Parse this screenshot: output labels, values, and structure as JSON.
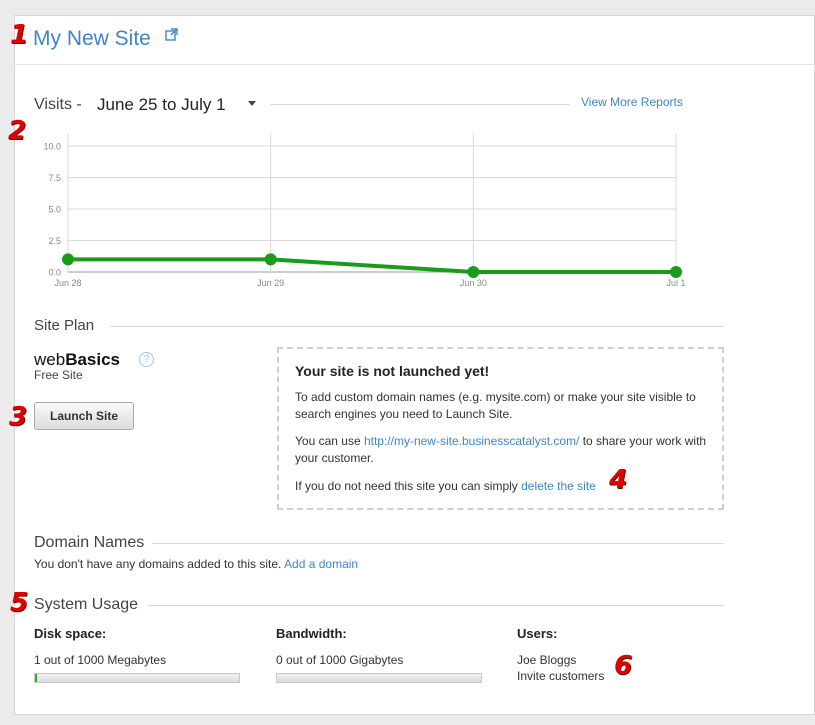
{
  "header": {
    "title": "My New Site"
  },
  "markers": [
    "1",
    "2",
    "3",
    "4",
    "5",
    "6"
  ],
  "visits": {
    "label": "Visits -",
    "range": "June 25 to July 1",
    "view_more": "View More Reports"
  },
  "chart_data": {
    "type": "line",
    "categories": [
      "Jun 28",
      "Jun 29",
      "Jun 30",
      "Jul 1"
    ],
    "series": [
      {
        "values": [
          1.0,
          1.0,
          0.0,
          0.0
        ],
        "color": "#1a9c1a"
      }
    ],
    "yticks": [
      "10.0",
      "7.5",
      "5.0",
      "2.5",
      "0.0"
    ],
    "ylim": [
      0,
      10
    ],
    "grid": true
  },
  "site_plan": {
    "label": "Site Plan",
    "plan_prefix": "web",
    "plan_bold": "Basics",
    "plan_sub": "Free Site",
    "help_icon": "?",
    "launch_button": "Launch Site"
  },
  "notice": {
    "title": "Your site is not launched yet!",
    "p1": "To add custom domain names (e.g. mysite.com) or make your site visible to search engines you need to Launch Site.",
    "p2_before": "You can use ",
    "p2_link": "http://my-new-site.businesscatalyst.com/",
    "p2_after": " to share your work with your customer.",
    "p3_before": "If you do not need this site you can simply ",
    "p3_link": "delete the site"
  },
  "domains": {
    "label": "Domain Names",
    "text": "You don't have any domains added to this site. ",
    "link": "Add a domain"
  },
  "usage": {
    "label": "System Usage",
    "disk": {
      "heading": "Disk space:",
      "text": "1 out of 1000 Megabytes",
      "fraction": 0.001
    },
    "bandwidth": {
      "heading": "Bandwidth:",
      "text": "0 out of 1000 Gigabytes",
      "fraction": 0
    },
    "users": {
      "heading": "Users:",
      "name": "Joe Bloggs",
      "link": "Invite customers"
    }
  }
}
